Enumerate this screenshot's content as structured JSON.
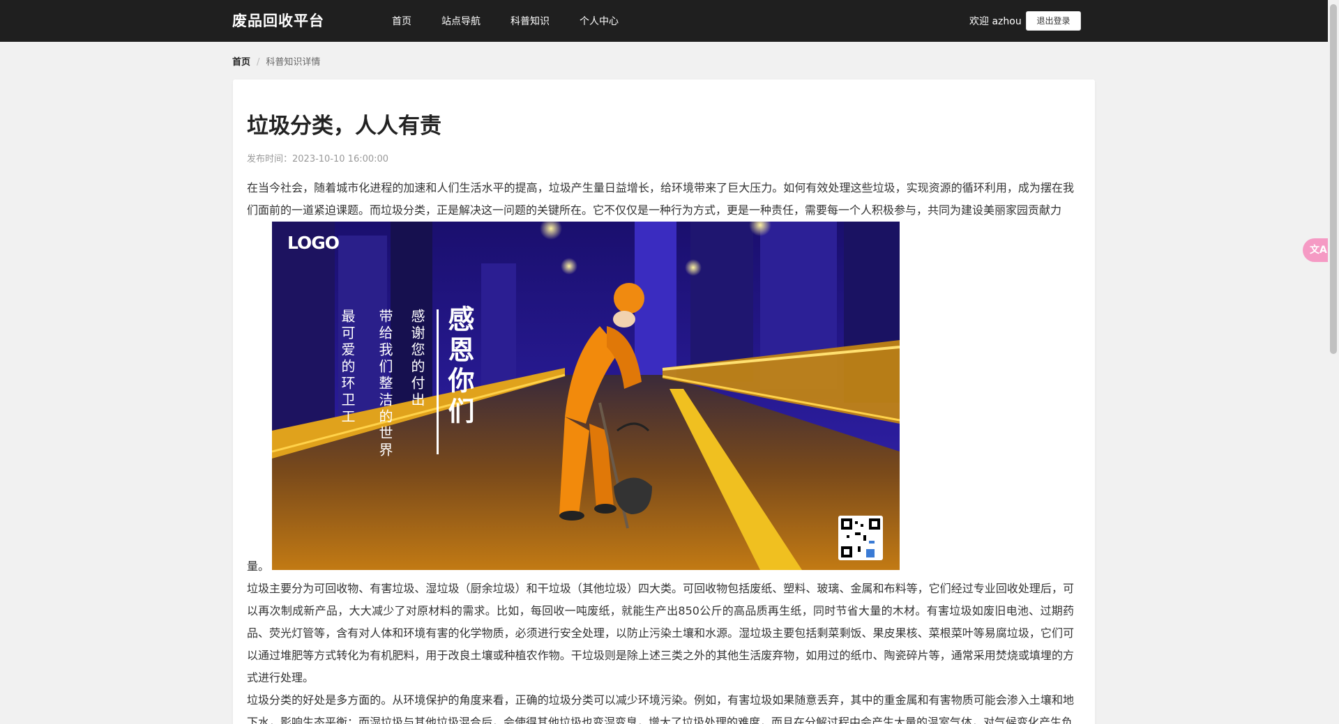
{
  "header": {
    "brand": "废品回收平台",
    "nav": [
      "首页",
      "站点导航",
      "科普知识",
      "个人中心"
    ],
    "welcome": "欢迎 azhou",
    "logout": "退出登录"
  },
  "breadcrumb": {
    "home": "首页",
    "separator": "/",
    "current": "科普知识详情"
  },
  "article": {
    "title": "垃圾分类，人人有责",
    "publish_time": "发布时间：2023-10-10 16:00:00",
    "paragraph1": "在当今社会，随着城市化进程的加速和人们生活水平的提高，垃圾产生量日益增长，给环境带来了巨大压力。如何有效处理这些垃圾，实现资源的循环利用，成为摆在我们面前的一道紧迫课题。而垃圾分类，正是解决这一问题的关键所在。它不仅仅是一种行为方式，更是一种责任，需要每一个人积极参与，共同为建设美丽家园贡献力",
    "paragraph1_tail": "量。",
    "paragraph2": "垃圾主要分为可回收物、有害垃圾、湿垃圾（厨余垃圾）和干垃圾（其他垃圾）四大类。可回收物包括废纸、塑料、玻璃、金属和布料等，它们经过专业回收处理后，可以再次制成新产品，大大减少了对原材料的需求。比如，每回收一吨废纸，就能生产出850公斤的高品质再生纸，同时节省大量的木材。有害垃圾如废旧电池、过期药品、荧光灯管等，含有对人体和环境有害的化学物质，必须进行安全处理，以防止污染土壤和水源。湿垃圾主要包括剩菜剩饭、果皮果核、菜根菜叶等易腐垃圾，它们可以通过堆肥等方式转化为有机肥料，用于改良土壤或种植农作物。干垃圾则是除上述三类之外的其他生活废弃物，如用过的纸巾、陶瓷碎片等，通常采用焚烧或填埋的方式进行处理。",
    "paragraph3": "垃圾分类的好处是多方面的。从环境保护的角度来看，正确的垃圾分类可以减少环境污染。例如，有害垃圾如果随意丢弃，其中的重金属和有害物质可能会渗入土壤和地下水，影响生态平衡；而湿垃圾与其他垃圾混合后，会使得其他垃圾也变湿变臭，增大了垃圾处理的难度，而且在分解过程中会产生大量的温室气体，对气候变化产生负"
  },
  "poster": {
    "logo": "LOGO",
    "headline": "感恩你们",
    "line1": "感谢您的付出",
    "line2": "带给我们整洁的世界",
    "line3": "最可爱的环卫工"
  },
  "floating": {
    "translate_icon": "文A"
  }
}
